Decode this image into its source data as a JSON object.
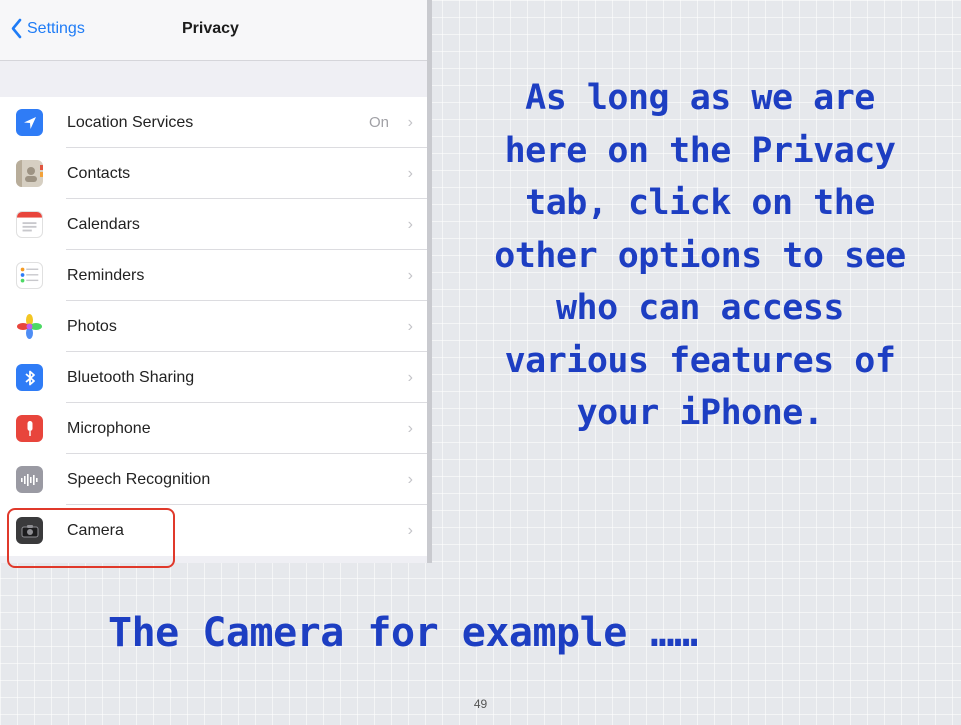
{
  "nav": {
    "back_label": "Settings",
    "title": "Privacy"
  },
  "rows": [
    {
      "label": "Location Services",
      "value": "On",
      "icon": "location-arrow-icon",
      "color": "#2f7cf6"
    },
    {
      "label": "Contacts",
      "value": "",
      "icon": "contacts-icon",
      "color": "#c9bfae"
    },
    {
      "label": "Calendars",
      "value": "",
      "icon": "calendar-icon",
      "color": "#e8453c"
    },
    {
      "label": "Reminders",
      "value": "",
      "icon": "reminders-list-icon",
      "color": "#f59b23"
    },
    {
      "label": "Photos",
      "value": "",
      "icon": "photos-flower-icon",
      "color": "#f3c623"
    },
    {
      "label": "Bluetooth Sharing",
      "value": "",
      "icon": "bluetooth-icon",
      "color": "#2f7cf6"
    },
    {
      "label": "Microphone",
      "value": "",
      "icon": "microphone-icon",
      "color": "#e8453c"
    },
    {
      "label": "Speech Recognition",
      "value": "",
      "icon": "speech-waveform-icon",
      "color": "#9a9aa3"
    },
    {
      "label": "Camera",
      "value": "",
      "icon": "camera-icon",
      "color": "#3a3a3c"
    }
  ],
  "chevron": "›",
  "caption": {
    "lines": [
      "As long as we are",
      "here on the Privacy",
      "tab, click on the",
      "other options to see",
      "who can access",
      "various features of",
      "your iPhone."
    ]
  },
  "example_text": "The Camera for example ……",
  "page_number": "49",
  "colors": {
    "accent_blue": "#1f7cf6",
    "caption_blue": "#1d3ec2",
    "highlight_red": "#e0392b"
  }
}
